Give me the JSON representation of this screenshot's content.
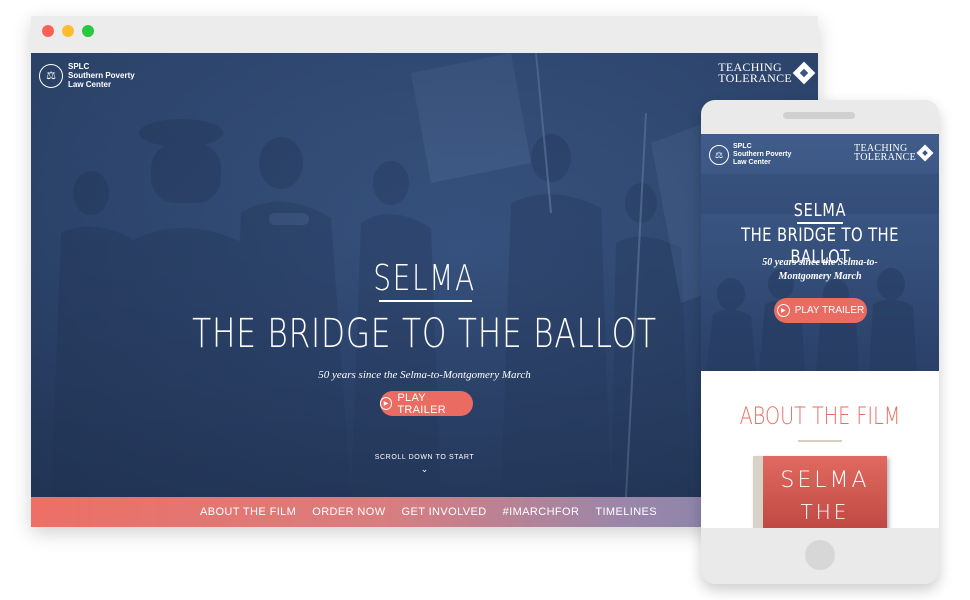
{
  "desktop": {
    "header": {
      "splc_logo": {
        "abbr": "SPLC",
        "line1": "Southern Poverty",
        "line2": "Law Center"
      },
      "tt_logo": {
        "line1": "TEACHING",
        "line2": "TOLERANCE"
      }
    },
    "hero": {
      "title": "SELMA",
      "subtitle": "THE BRIDGE TO THE BALLOT",
      "tagline": "50 years since the Selma-to-Montgomery March",
      "play_label": "PLAY TRAILER",
      "scroll_label": "SCROLL DOWN TO START",
      "scroll_icon": "chevron-down-icon"
    },
    "nav": [
      "ABOUT THE FILM",
      "ORDER NOW",
      "GET INVOLVED",
      "#IMARCHFOR",
      "TIMELINES"
    ],
    "window_controls": [
      "close",
      "minimize",
      "maximize"
    ]
  },
  "mobile": {
    "header": {
      "splc_logo": {
        "abbr": "SPLC",
        "line1": "Southern Poverty",
        "line2": "Law Center"
      },
      "tt_logo": {
        "line1": "TEACHING",
        "line2": "TOLERANCE"
      }
    },
    "hero": {
      "title": "SELMA",
      "subtitle": "THE BRIDGE TO THE BALLOT",
      "tagline_line1": "50 years since the Selma-to-",
      "tagline_line2": "Montgomery March",
      "play_label": "PLAY TRAILER"
    },
    "about": {
      "heading": "ABOUT THE FILM",
      "dvd_title_1": "SELMA",
      "dvd_title_2": "THE"
    }
  },
  "colors": {
    "accent": "#ea6b62",
    "hero_blue": "#36507c",
    "nav_gradient_start": "#ee6f65",
    "nav_gradient_end": "#7e83ad"
  }
}
